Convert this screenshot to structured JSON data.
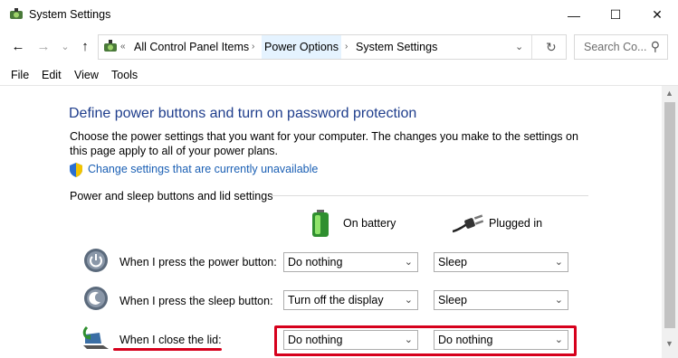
{
  "window": {
    "title": "System Settings",
    "controls": {
      "minimize": "—",
      "maximize": "☐",
      "close": "✕"
    }
  },
  "nav": {
    "back": "←",
    "forward": "→",
    "recent": "⌄",
    "up": "↑",
    "refresh": "↻",
    "overflow": "«"
  },
  "breadcrumb": [
    "All Control Panel Items",
    "Power Options",
    "System Settings"
  ],
  "search": {
    "placeholder": "Search Co...",
    "icon": "⚲"
  },
  "menu": [
    "File",
    "Edit",
    "View",
    "Tools"
  ],
  "main": {
    "heading": "Define power buttons and turn on password protection",
    "description": "Choose the power settings that you want for your computer. The changes you make to the settings on this page apply to all of your power plans.",
    "change_link": "Change settings that are currently unavailable",
    "section_title": "Power and sleep buttons and lid settings",
    "columns": {
      "battery": "On battery",
      "plugged": "Plugged in"
    },
    "rows": [
      {
        "label": "When I press the power button:",
        "battery": "Do nothing",
        "plugged": "Sleep"
      },
      {
        "label": "When I press the sleep button:",
        "battery": "Turn off the display",
        "plugged": "Sleep"
      },
      {
        "label": "When I close the lid:",
        "battery": "Do nothing",
        "plugged": "Do nothing"
      }
    ]
  },
  "colors": {
    "heading": "#1e3d8c",
    "link": "#1a5fb4",
    "highlight": "#d6001c"
  }
}
